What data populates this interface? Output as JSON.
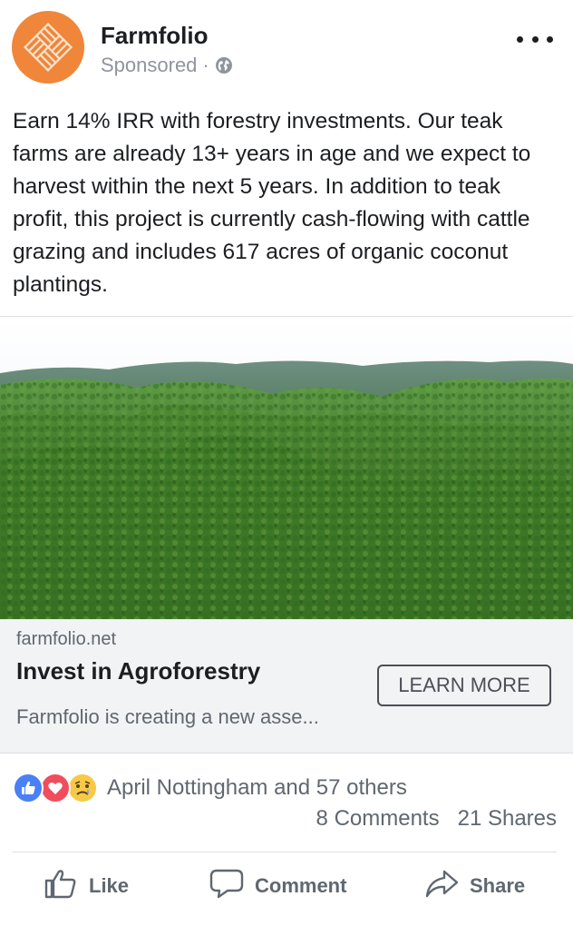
{
  "post": {
    "page_name": "Farmfolio",
    "sponsored_label": "Sponsored",
    "meta_separator": "·",
    "text": "Earn 14% IRR with forestry investments. Our teak farms are already 13+ years in age and we expect to harvest within the next 5 years. In addition to teak profit, this project is currently cash-flowing with cattle grazing and includes 617 acres of organic coconut plantings."
  },
  "link_preview": {
    "domain": "farmfolio.net",
    "title": "Invest in Agroforestry",
    "description": "Farmfolio is creating a new asse...",
    "cta_label": "LEARN MORE"
  },
  "engagement": {
    "reactions": [
      "like-reaction",
      "love-reaction",
      "sad-reaction"
    ],
    "reactors_text": "April Nottingham and 57 others",
    "comments_text": "8 Comments",
    "shares_text": "21 Shares"
  },
  "actions": {
    "like_label": "Like",
    "comment_label": "Comment",
    "share_label": "Share"
  },
  "colors": {
    "brand_orange": "#f0863a",
    "like_blue": "#4a80f5",
    "love_red": "#f04d5d",
    "sad_yellow": "#f7c948"
  }
}
